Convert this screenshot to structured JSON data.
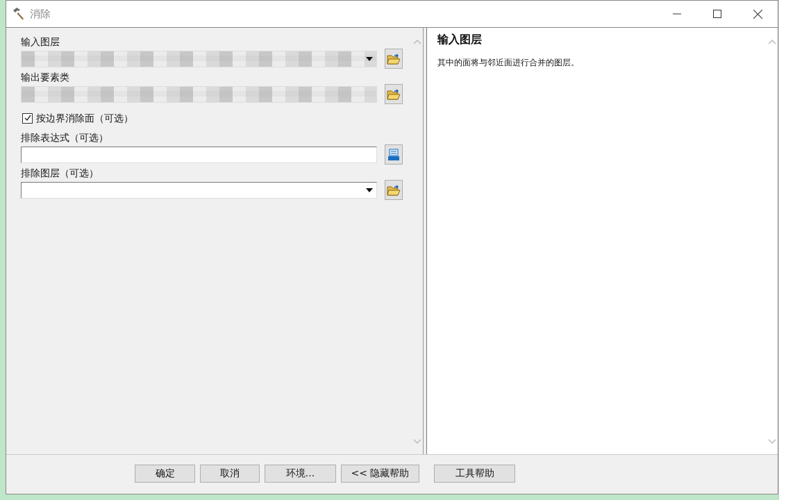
{
  "window": {
    "title": "消除"
  },
  "parameters": [
    {
      "kind": "dropdown",
      "label": "输入图层",
      "redacted": true
    },
    {
      "kind": "field",
      "label": "输出要素类",
      "redacted": true
    },
    {
      "kind": "checkbox",
      "label": "按边界消除面（可选）",
      "checked": true
    },
    {
      "kind": "sql",
      "label": "排除表达式（可选）",
      "redacted": false
    },
    {
      "kind": "dropdown",
      "label": "排除图层（可选）",
      "redacted": false
    }
  ],
  "help": {
    "title": "输入图层",
    "text": "其中的面将与邻近面进行合并的图层。"
  },
  "buttons": [
    "确定",
    "取消",
    "环境...",
    "<< 隐藏帮助",
    "工具帮助"
  ]
}
